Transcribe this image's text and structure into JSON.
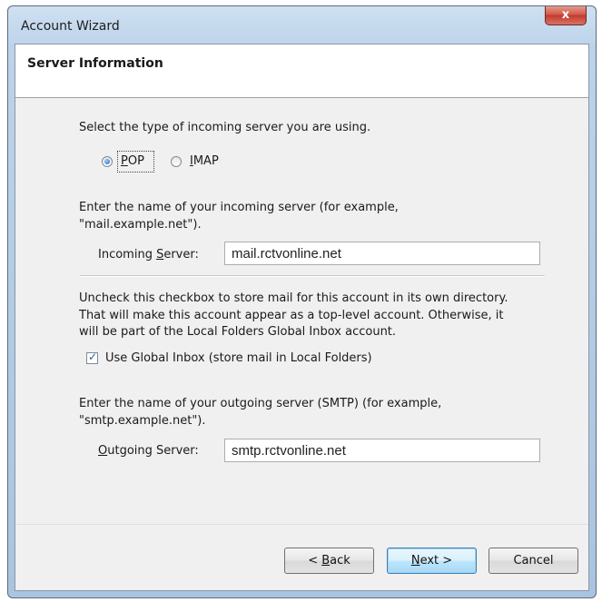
{
  "window": {
    "title": "Account Wizard",
    "close_glyph": "x"
  },
  "header": {
    "title": "Server Information"
  },
  "server_type": {
    "prompt": "Select the type of incoming server you are using.",
    "options": [
      {
        "label_pre": "",
        "label_accel": "P",
        "label_post": "OP",
        "selected": true
      },
      {
        "label_pre": "",
        "label_accel": "I",
        "label_post": "MAP",
        "selected": false
      }
    ]
  },
  "incoming": {
    "desc_line1": "Enter the name of your incoming server (for example,",
    "desc_line2": "\"mail.example.net\").",
    "label_pre": "Incoming ",
    "label_accel": "S",
    "label_post": "erver:",
    "value": "mail.rctvonline.net"
  },
  "global_inbox": {
    "desc_line1": "Uncheck this checkbox to store mail for this account in its own directory.",
    "desc_line2": "That will make this account appear as a top-level account. Otherwise, it",
    "desc_line3": "will be part of the Local Folders Global Inbox account.",
    "checkbox_label": "Use Global Inbox (store mail in Local Folders)",
    "checked": true
  },
  "outgoing": {
    "desc_line1": "Enter the name of your outgoing server (SMTP) (for example,",
    "desc_line2": "\"smtp.example.net\").",
    "label_pre": "",
    "label_accel": "O",
    "label_post": "utgoing Server:",
    "value": "smtp.rctvonline.net"
  },
  "buttons": {
    "back": {
      "pre": "< ",
      "accel": "B",
      "post": "ack"
    },
    "next": {
      "pre": "",
      "accel": "N",
      "post": "ext >"
    },
    "cancel": {
      "label": "Cancel"
    }
  },
  "icons": {
    "check": "checkmark-icon",
    "close": "close-icon"
  }
}
